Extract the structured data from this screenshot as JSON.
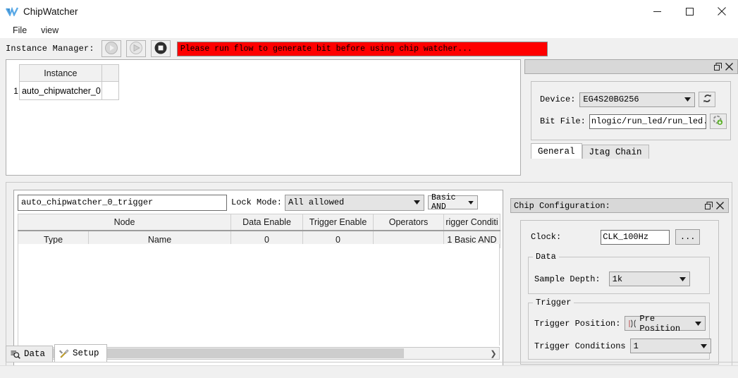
{
  "window": {
    "title": "ChipWatcher",
    "logo_icon": "chipwatcher-logo-icon",
    "minimize_icon": "minimize-icon",
    "maximize_icon": "maximize-icon",
    "close_icon": "close-icon"
  },
  "menubar": {
    "items": [
      {
        "label": "File"
      },
      {
        "label": "view"
      }
    ]
  },
  "instance_manager": {
    "label": "Instance Manager:",
    "buttons": [
      {
        "name": "run-button",
        "icon": "play-circle-icon",
        "enabled": false
      },
      {
        "name": "step-button",
        "icon": "play-triangle-icon",
        "enabled": false
      },
      {
        "name": "stop-button",
        "icon": "stop-circle-icon",
        "enabled": true
      }
    ],
    "message": "Please run flow to generate bit before using chip watcher...",
    "message_color": "#ff0000",
    "table": {
      "headers": [
        "Instance"
      ],
      "rows": [
        {
          "index": "1",
          "instance": "auto_chipwatcher_0"
        }
      ]
    }
  },
  "device_dock": {
    "title": "",
    "float_icon": "restore-icon",
    "close_icon": "close-icon",
    "device": {
      "label": "Device:",
      "value": "EG4S20BG256",
      "refresh_icon": "refresh-icon"
    },
    "bit_file": {
      "label": "Bit File:",
      "value": "nlogic/run_led/run_led.bit",
      "load_icon": "load-bit-icon"
    },
    "tabs": [
      {
        "label": "General",
        "active": true
      },
      {
        "label": "Jtag Chain",
        "active": false
      }
    ]
  },
  "trigger_editor": {
    "name_value": "auto_chipwatcher_0_trigger",
    "lock_mode": {
      "label": "Lock Mode:",
      "value": "All allowed"
    },
    "basic_and": {
      "value": "Basic AND"
    },
    "columns": [
      {
        "label": "Node",
        "span": 2
      },
      {
        "label": "Data Enable",
        "span": 1
      },
      {
        "label": "Trigger Enable",
        "span": 1
      },
      {
        "label": "Operators",
        "span": 1
      },
      {
        "label": "rigger Conditi",
        "span": 1
      }
    ],
    "subcolumns": [
      "Type",
      "Name",
      "0",
      "0",
      "",
      "1 Basic AND"
    ],
    "rows": [],
    "scrollbar": {
      "left_icon": "chevron-left-icon",
      "right_icon": "chevron-right-icon"
    }
  },
  "chip_configuration": {
    "title": "Chip Configuration:",
    "float_icon": "restore-icon",
    "close_icon": "close-icon",
    "clock": {
      "label": "Clock:",
      "value": "CLK_100Hz",
      "browse_label": "..."
    },
    "data_group": {
      "legend": "Data",
      "sample_depth": {
        "label": "Sample Depth:",
        "value": "1k"
      }
    },
    "trigger_group": {
      "legend": "Trigger",
      "trigger_position": {
        "label": "Trigger Position:",
        "value": "Pre Position",
        "icon": "trigger-position-icon"
      },
      "trigger_conditions": {
        "label": "Trigger Conditions",
        "value": "1"
      }
    }
  },
  "bottom_tabs": [
    {
      "label": "Data",
      "icon": "data-magnifier-icon",
      "active": false
    },
    {
      "label": "Setup",
      "icon": "setup-tools-icon",
      "active": true
    }
  ]
}
